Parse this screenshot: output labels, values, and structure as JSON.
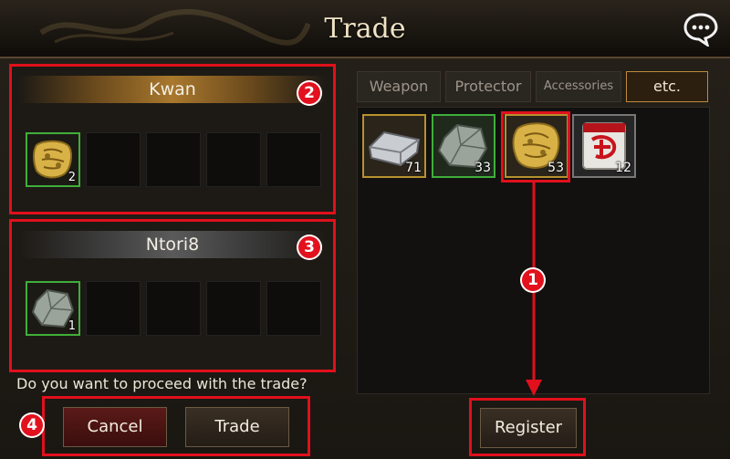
{
  "window": {
    "title": "Trade"
  },
  "traders": [
    {
      "name": "Kwan",
      "slots": [
        {
          "item": "gold-coin",
          "count": "2"
        }
      ]
    },
    {
      "name": "Ntori8",
      "slots": [
        {
          "item": "stone-ore",
          "count": "1"
        }
      ]
    }
  ],
  "prompt": "Do you want to proceed with the trade?",
  "buttons": {
    "cancel": "Cancel",
    "trade": "Trade",
    "register": "Register"
  },
  "tabs": [
    "Weapon",
    "Protector",
    "Accessories",
    "etc."
  ],
  "active_tab": "etc.",
  "inventory": [
    {
      "item": "silver-ingot",
      "count": "71"
    },
    {
      "item": "stone-ore",
      "count": "33"
    },
    {
      "item": "gold-coin",
      "count": "53"
    },
    {
      "item": "red-seal-scroll",
      "count": "12"
    }
  ],
  "callouts": [
    "1",
    "2",
    "3",
    "4"
  ],
  "colors": {
    "highlight": "#e0101c",
    "active_tab_border": "#bd8a3a",
    "slot_border": "#3fae3a"
  },
  "icons": [
    "chat-bubble-icon",
    "gold-coin-icon",
    "stone-ore-icon",
    "silver-ingot-icon",
    "red-seal-scroll-icon"
  ]
}
